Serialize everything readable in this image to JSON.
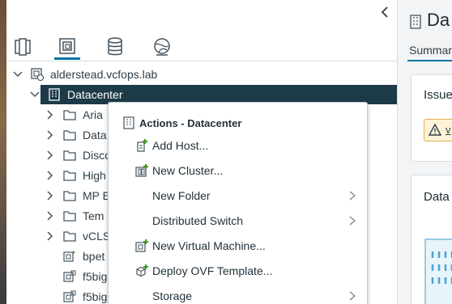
{
  "tree": {
    "root": {
      "label": "alderstead.vcfops.lab"
    },
    "datacenter": {
      "label": "Datacenter"
    },
    "children": [
      {
        "label": "Aria",
        "type": "folder"
      },
      {
        "label": "Data",
        "type": "folder"
      },
      {
        "label": "Disco",
        "type": "folder"
      },
      {
        "label": "High",
        "type": "folder"
      },
      {
        "label": "MP E",
        "type": "folder"
      },
      {
        "label": "Tem",
        "type": "folder"
      },
      {
        "label": "vCLS",
        "type": "folder"
      },
      {
        "label": "bpet",
        "type": "vm"
      },
      {
        "label": "f5big",
        "type": "vm"
      },
      {
        "label": "f5big",
        "type": "vm"
      }
    ]
  },
  "context_menu": {
    "title": "Actions - Datacenter",
    "items": [
      {
        "label": "Add Host...",
        "icon": "add-host-icon",
        "submenu": false
      },
      {
        "label": "New Cluster...",
        "icon": "new-cluster-icon",
        "submenu": false
      },
      {
        "label": "New Folder",
        "icon": "",
        "submenu": true
      },
      {
        "label": "Distributed Switch",
        "icon": "",
        "submenu": true
      },
      {
        "label": "New Virtual Machine...",
        "icon": "new-vm-icon",
        "submenu": false
      },
      {
        "label": "Deploy OVF Template...",
        "icon": "deploy-ovf-icon",
        "submenu": false
      },
      {
        "label": "Storage",
        "icon": "",
        "submenu": true
      }
    ]
  },
  "right_panel": {
    "title": "Da",
    "tab": "Summar",
    "issues_title": "Issue",
    "warning_text": "v",
    "data_title": "Data"
  },
  "colors": {
    "selected_bg": "#1d3a48",
    "accent": "#0072a3",
    "plus_green": "#3c9c1e"
  }
}
